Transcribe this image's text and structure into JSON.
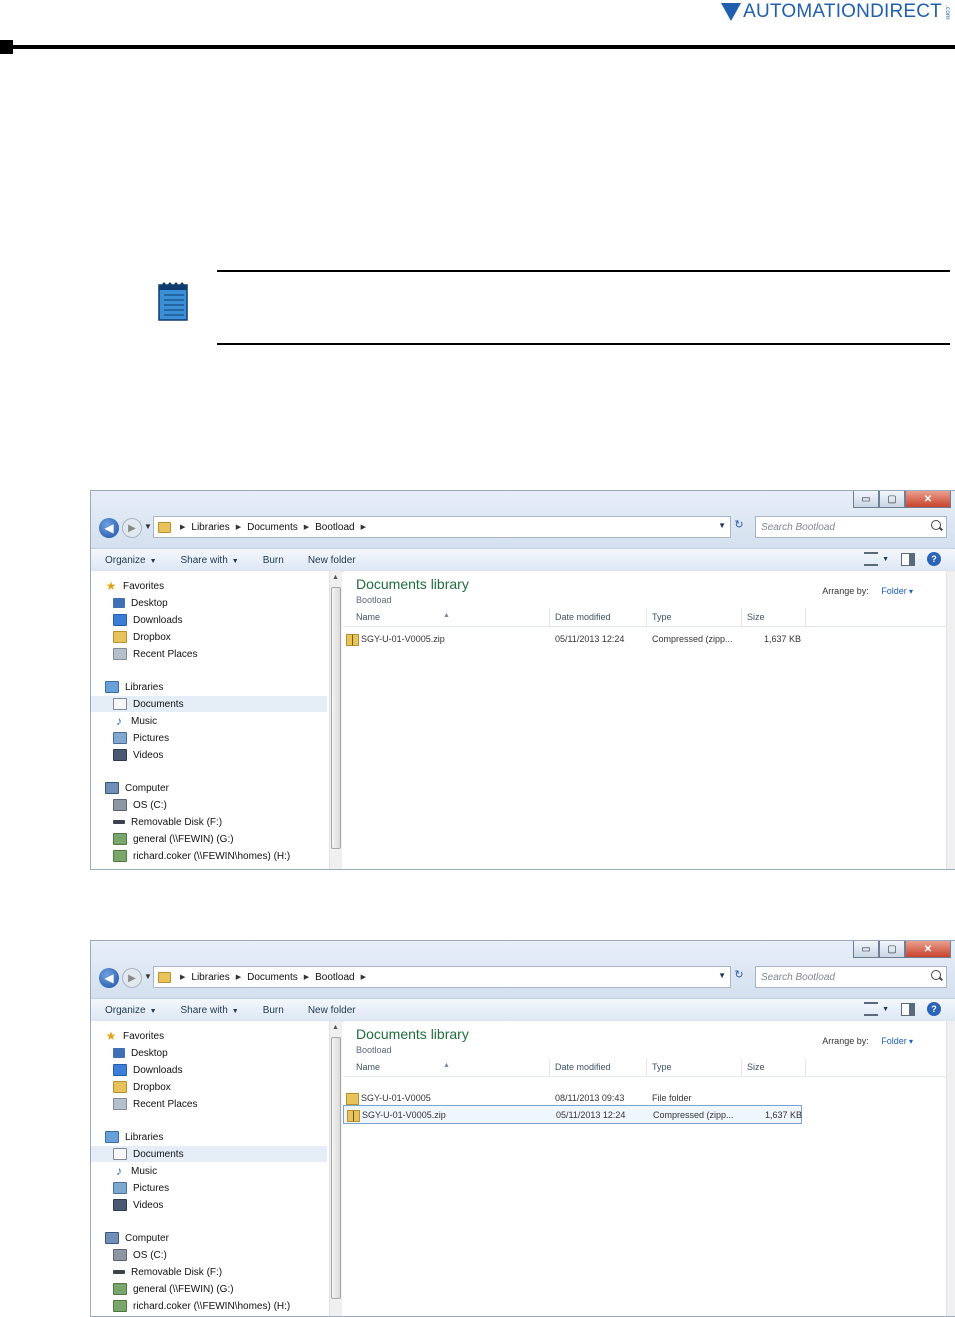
{
  "header": {
    "logo_text": "AUTOMATIONDIRECT",
    "logo_suffix": ".com"
  },
  "windows": [
    {
      "address": {
        "crumbs": [
          "Libraries",
          "Documents",
          "Bootload"
        ]
      },
      "search_placeholder": "Search Bootload",
      "window_controls": {
        "minimize": "▭",
        "maximize": "▢",
        "close": "✕"
      },
      "commands": [
        "Organize",
        "Share with",
        "Burn",
        "New folder"
      ],
      "nav": {
        "favorites": [
          "Favorites",
          "Desktop",
          "Downloads",
          "Dropbox",
          "Recent Places"
        ],
        "libraries": [
          "Libraries",
          "Documents",
          "Music",
          "Pictures",
          "Videos"
        ],
        "computer": [
          "Computer",
          "OS (C:)",
          "Removable Disk (F:)",
          "general (\\\\FEWIN) (G:)",
          "richard.coker (\\\\FEWIN\\homes) (H:)"
        ]
      },
      "library_title": "Documents library",
      "library_subtitle": "Bootload",
      "arrange_label": "Arrange by:",
      "arrange_value": "Folder",
      "columns": [
        "Name",
        "Date modified",
        "Type",
        "Size"
      ],
      "rows": [
        {
          "name": "SGY-U-01-V0005.zip",
          "date": "05/11/2013 12:24",
          "type": "Compressed (zipp...",
          "size": "1,637 KB"
        }
      ]
    },
    {
      "address": {
        "crumbs": [
          "Libraries",
          "Documents",
          "Bootload"
        ]
      },
      "search_placeholder": "Search Bootload",
      "window_controls": {
        "minimize": "▭",
        "maximize": "▢",
        "close": "✕"
      },
      "commands": [
        "Organize",
        "Share with",
        "Burn",
        "New folder"
      ],
      "nav": {
        "favorites": [
          "Favorites",
          "Desktop",
          "Downloads",
          "Dropbox",
          "Recent Places"
        ],
        "libraries": [
          "Libraries",
          "Documents",
          "Music",
          "Pictures",
          "Videos"
        ],
        "computer": [
          "Computer",
          "OS (C:)",
          "Removable Disk (F:)",
          "general (\\\\FEWIN) (G:)",
          "richard.coker (\\\\FEWIN\\homes) (H:)"
        ]
      },
      "library_title": "Documents library",
      "library_subtitle": "Bootload",
      "arrange_label": "Arrange by:",
      "arrange_value": "Folder",
      "columns": [
        "Name",
        "Date modified",
        "Type",
        "Size"
      ],
      "rows": [
        {
          "name": "SGY-U-01-V0005",
          "date": "08/11/2013 09:43",
          "type": "File folder",
          "size": ""
        },
        {
          "name": "SGY-U-01-V0005.zip",
          "date": "05/11/2013 12:24",
          "type": "Compressed (zipp...",
          "size": "1,637 KB"
        }
      ]
    }
  ]
}
